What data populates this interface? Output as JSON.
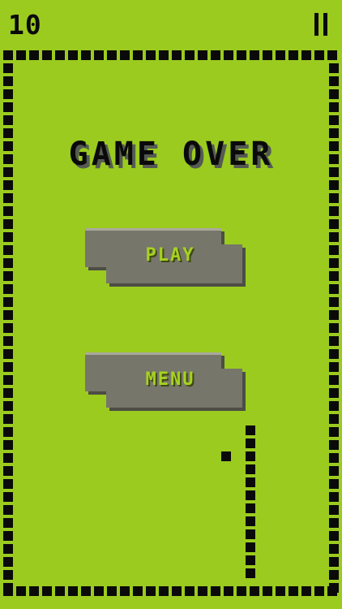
{
  "hud": {
    "score": "10",
    "pause_icon": "pause-icon"
  },
  "overlay": {
    "title": "GAME OVER",
    "play_label": "PLAY",
    "menu_label": "MENU"
  },
  "colors": {
    "background": "#9bcb1f",
    "ink": "#0a0a0a",
    "button_face": "#76766b",
    "button_shadow": "#4d4d45",
    "button_highlight": "#a9a99d",
    "label_text": "#a6d221"
  }
}
